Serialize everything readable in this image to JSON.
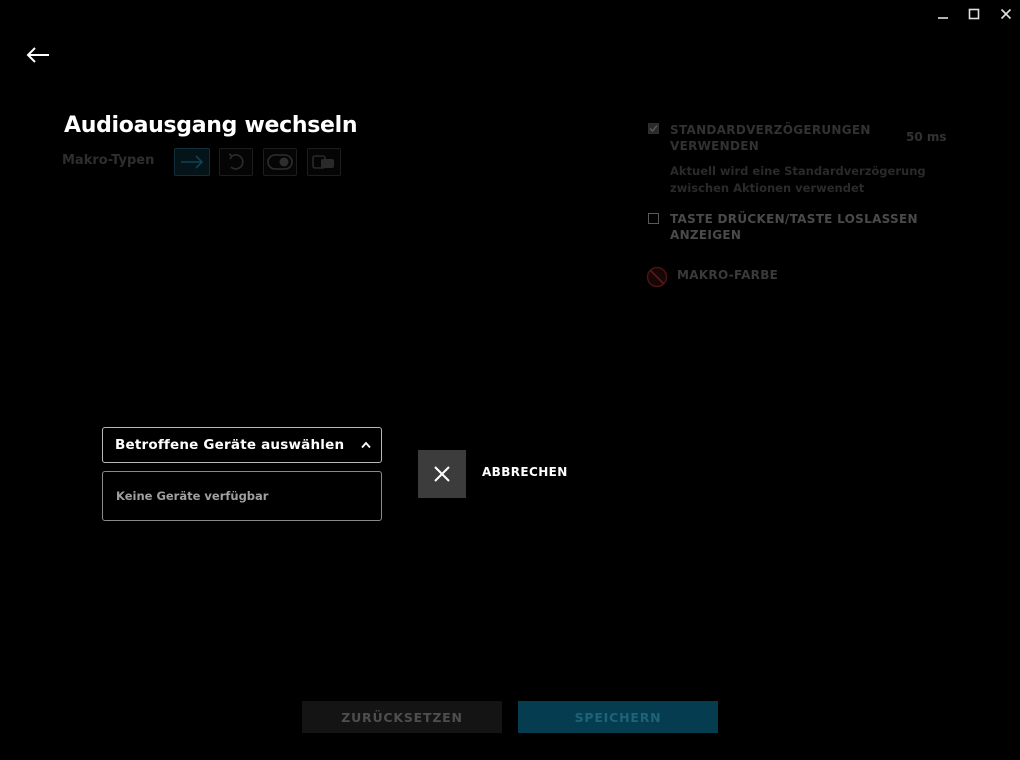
{
  "window": {
    "controls": {
      "minimize_icon": "minimize-icon",
      "maximize_icon": "maximize-icon",
      "close_icon": "close-icon"
    }
  },
  "header": {
    "back_icon": "arrow-left-icon",
    "title": "Audioausgang wechseln",
    "macro_types_label": "Makro-Typen",
    "macro_types": [
      {
        "icon": "arrow-right-icon",
        "selected": true
      },
      {
        "icon": "repeat-icon",
        "selected": false
      },
      {
        "icon": "toggle-icon",
        "selected": false
      },
      {
        "icon": "hold-key-icon",
        "selected": false
      }
    ]
  },
  "options": {
    "default_delays": {
      "label": "STANDARDVERZÖGERUNGEN VERWENDEN",
      "checked": true,
      "value": "50 ms",
      "description": "Aktuell wird eine Standardverzögerung zwischen Aktionen verwendet"
    },
    "press_release": {
      "label": "TASTE DRÜCKEN/TASTE LOSLASSEN ANZEIGEN",
      "checked": false
    },
    "macro_color": {
      "label": "MAKRO-FARBE",
      "icon": "no-color-icon"
    }
  },
  "device_picker": {
    "select_label": "Betroffene Geräte auswählen",
    "chevron_icon": "chevron-up-icon",
    "empty_text": "Keine Geräte verfügbar"
  },
  "cancel": {
    "icon": "close-icon",
    "label": "ABBRECHEN"
  },
  "footer": {
    "reset_label": "ZURÜCKSETZEN",
    "save_label": "SPEICHERN"
  },
  "colors": {
    "background": "#000000",
    "accent": "#063c4f",
    "accent_text": "#1d6479",
    "cancel_button": "#3c3c3c"
  }
}
